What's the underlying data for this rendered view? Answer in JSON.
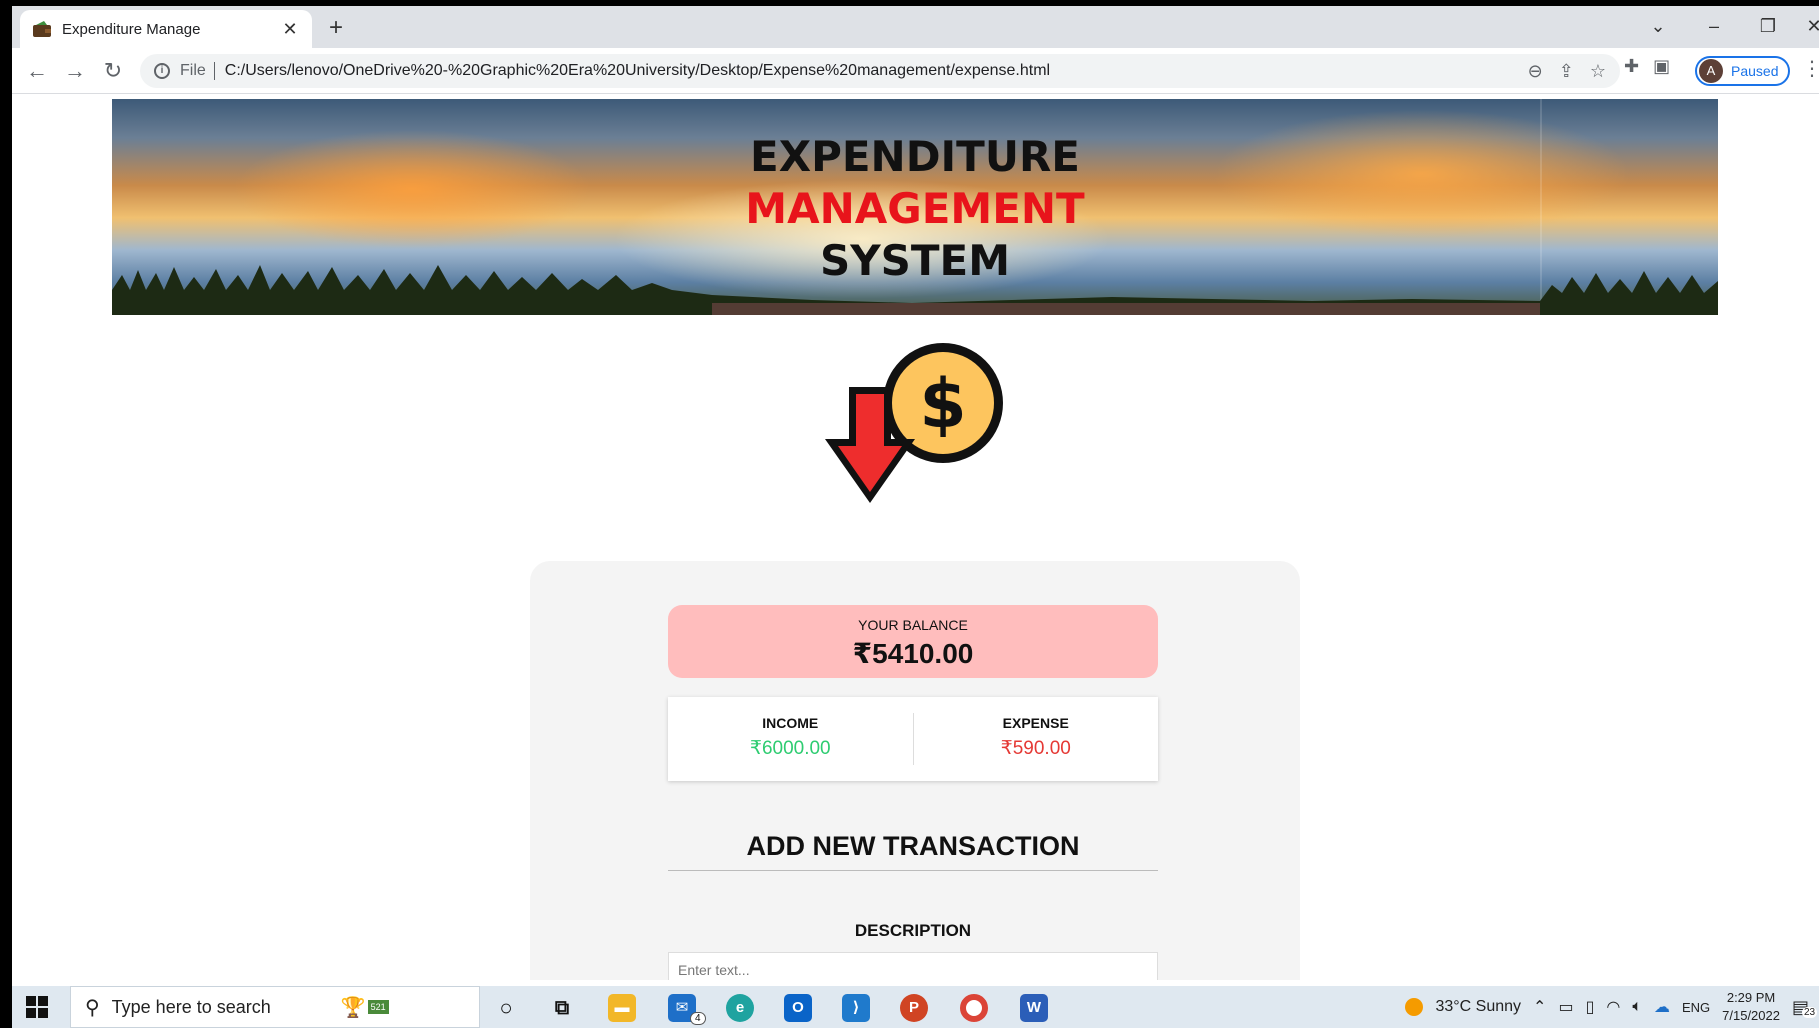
{
  "browser": {
    "tab_title": "Expenditure Manage",
    "address_prefix": "File",
    "url": "C:/Users/lenovo/OneDrive%20-%20Graphic%20Era%20University/Desktop/Expense%20management/expense.html",
    "profile_initial": "A",
    "profile_status": "Paused"
  },
  "banner": {
    "line1": "EXPENDITURE",
    "line2": "MANAGEMENT",
    "line3": "SYSTEM",
    "accent_color": "#e8141b"
  },
  "balance": {
    "label": "YOUR BALANCE",
    "amount": "₹5410.00"
  },
  "summary": {
    "income_label": "INCOME",
    "income_value": "₹6000.00",
    "expense_label": "EXPENSE",
    "expense_value": "₹590.00",
    "income_color": "#2ecc71",
    "expense_color": "#e53935"
  },
  "form": {
    "title": "ADD NEW TRANSACTION",
    "description_label": "DESCRIPTION",
    "description_placeholder": "Enter text..."
  },
  "taskbar": {
    "search_placeholder": "Type here to search",
    "weather": "33°C Sunny",
    "language": "ENG",
    "time": "2:29 PM",
    "date": "7/15/2022",
    "notification_count": "23",
    "mail_badge": "4",
    "cortana_badge": "521"
  }
}
